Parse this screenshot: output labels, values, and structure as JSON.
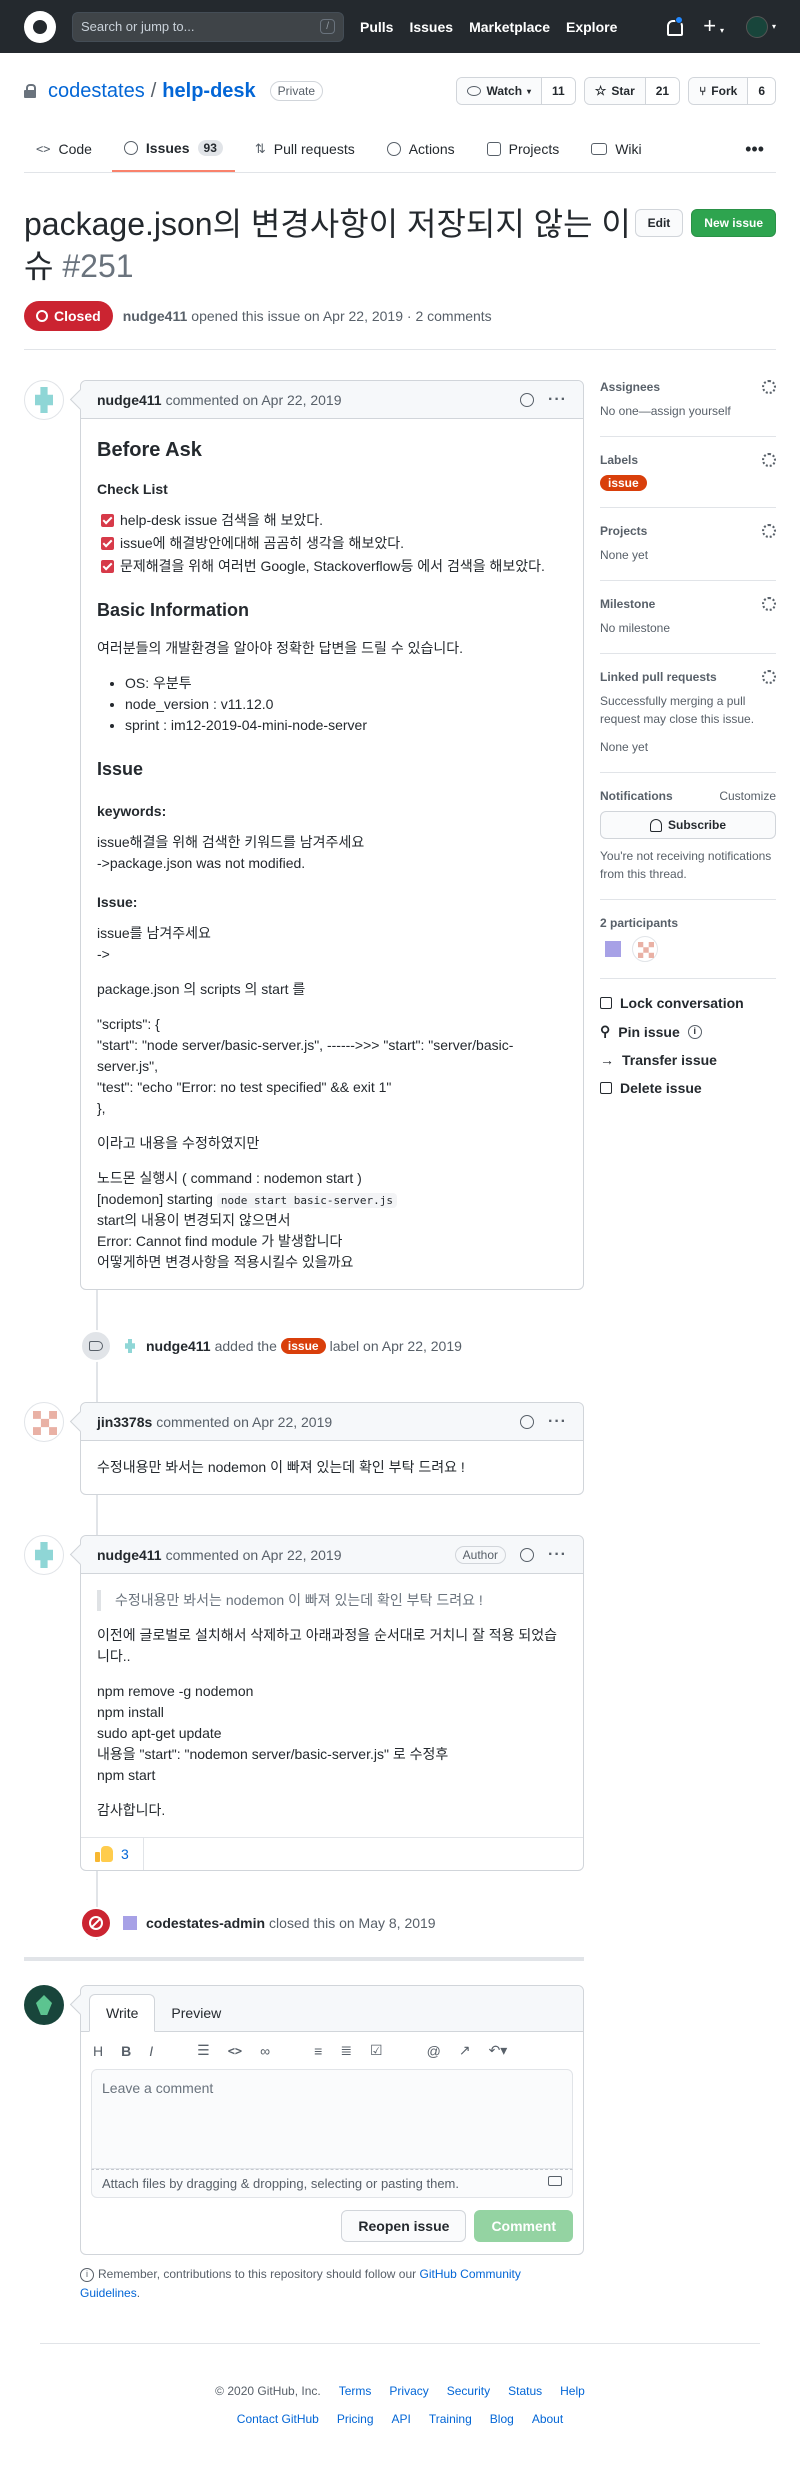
{
  "header": {
    "search_placeholder": "Search or jump to...",
    "slash": "/",
    "nav": [
      "Pulls",
      "Issues",
      "Marketplace",
      "Explore"
    ],
    "plus": "+",
    "caret": "▾"
  },
  "repo": {
    "owner": "codestates",
    "sep": "/",
    "name": "help-desk",
    "private": "Private",
    "watch_label": "Watch",
    "watch_count": "11",
    "star_label": "Star",
    "star_count": "21",
    "fork_label": "Fork",
    "fork_count": "6"
  },
  "tabs": [
    {
      "label": "Code"
    },
    {
      "label": "Issues",
      "count": "93"
    },
    {
      "label": "Pull requests"
    },
    {
      "label": "Actions"
    },
    {
      "label": "Projects"
    },
    {
      "label": "Wiki"
    }
  ],
  "issue": {
    "title": "package.json의 변경사항이 저장되지 않는 이슈",
    "number": "#251",
    "edit_btn": "Edit",
    "new_issue_btn": "New issue",
    "state": "Closed",
    "author": "nudge411",
    "meta": "opened this issue on Apr 22, 2019 · 2 comments"
  },
  "comments": {
    "c1": {
      "author": "nudge411",
      "time": "commented on Apr 22, 2019",
      "h_before_ask": "Before Ask",
      "h_checklist": "Check List",
      "tasks": [
        "help-desk issue 검색을 해 보았다.",
        "issue에 해결방안에대해 곰곰히 생각을 해보았다.",
        "문제해결을 위해 여러번 Google, Stackoverflow등 에서 검색을 해보았다."
      ],
      "h_basic": "Basic Information",
      "basic_desc": "여러분들의 개발환경을 알아야 정확한 답변을 드릴 수 있습니다.",
      "env": [
        "OS: 우분투",
        "node_version : v11.12.0",
        "sprint : im12-2019-04-mini-node-server"
      ],
      "h_issue": "Issue",
      "h_keywords": "keywords:",
      "kw1": "issue해결을 위해 검색한 키워드를 남겨주세요",
      "kw2": "->package.json was not modified.",
      "h_issue2": "Issue:",
      "is1": "issue를 남겨주세요",
      "is2": "->",
      "is3": "package.json 의 scripts 의 start 를",
      "sc1": "\"scripts\": {",
      "sc2": "\"start\": \"node server/basic-server.js\", ------>>> \"start\": \"server/basic-server.js\",",
      "sc3": "\"test\": \"echo \"Error: no test specified\" && exit 1\"",
      "sc4": "},",
      "fix": "이라고 내용을 수정하였지만",
      "r1": "노드몬 실행시 ( command : nodemon start )",
      "r2_pre": "[nodemon] starting",
      "r2_code": "node start basic-server.js",
      "r3": "start의 내용이 변경되지 않으면서",
      "r4": "Error: Cannot find module 가 발생합니다",
      "r5": "어떻게하면 변경사항을 적용시킬수 있을까요"
    },
    "event_label": {
      "actor": "nudge411",
      "pre": "added the",
      "label": "issue",
      "post": "label on Apr 22, 2019"
    },
    "c2": {
      "author": "jin3378s",
      "time": "commented on Apr 22, 2019",
      "body": "수정내용만 봐서는 nodemon 이 빠져 있는데 확인 부탁 드려요 !"
    },
    "c3": {
      "author": "nudge411",
      "time": "commented on Apr 22, 2019",
      "badge": "Author",
      "quote": "수정내용만 봐서는 nodemon 이 빠져 있는데 확인 부탁 드려요 !",
      "p1": "이전에 글로벌로 설치해서 삭제하고 아래과정을 순서대로 거치니 잘 적용 되었습니다..",
      "l1": "npm remove -g nodemon",
      "l2": "npm install",
      "l3": "sudo apt-get update",
      "l4": "내용을 \"start\": \"nodemon server/basic-server.js\" 로 수정후",
      "l5": "npm start",
      "thanks": "감사합니다.",
      "reaction_count": "3"
    },
    "event_close": {
      "actor": "codestates-admin",
      "text": "closed this on May 8, 2019"
    }
  },
  "editor": {
    "tab_write": "Write",
    "tab_preview": "Preview",
    "tools": [
      "H",
      "B",
      "I"
    ],
    "placeholder": "Leave a comment",
    "attach": "Attach files by dragging & dropping, selecting or pasting them.",
    "reopen": "Reopen issue",
    "comment": "Comment",
    "contrib_pre": "Remember, contributions to this repository should follow our",
    "contrib_link": "GitHub Community Guidelines",
    "contrib_post": "."
  },
  "sidebar": {
    "assignees_h": "Assignees",
    "assignees_v": "No one—assign yourself",
    "labels_h": "Labels",
    "labels_v": "issue",
    "projects_h": "Projects",
    "projects_v": "None yet",
    "milestone_h": "Milestone",
    "milestone_v": "No milestone",
    "linked_h": "Linked pull requests",
    "linked_desc": "Successfully merging a pull request may close this issue.",
    "linked_v": "None yet",
    "notif_h": "Notifications",
    "notif_customize": "Customize",
    "subscribe": "Subscribe",
    "notif_desc": "You're not receiving notifications from this thread.",
    "participants": "2 participants",
    "lock": "Lock conversation",
    "pin": "Pin issue",
    "transfer": "Transfer issue",
    "delete": "Delete issue"
  },
  "footer": {
    "copyright": "© 2020 GitHub, Inc.",
    "row1": [
      "Terms",
      "Privacy",
      "Security",
      "Status",
      "Help"
    ],
    "row2": [
      "Contact GitHub",
      "Pricing",
      "API",
      "Training",
      "Blog",
      "About"
    ]
  },
  "colors": {
    "header_bg": "#24292e",
    "closed": "#cb2431",
    "label_issue": "#d93f0b",
    "new_issue": "#2ea44f",
    "link": "#0366d6"
  }
}
